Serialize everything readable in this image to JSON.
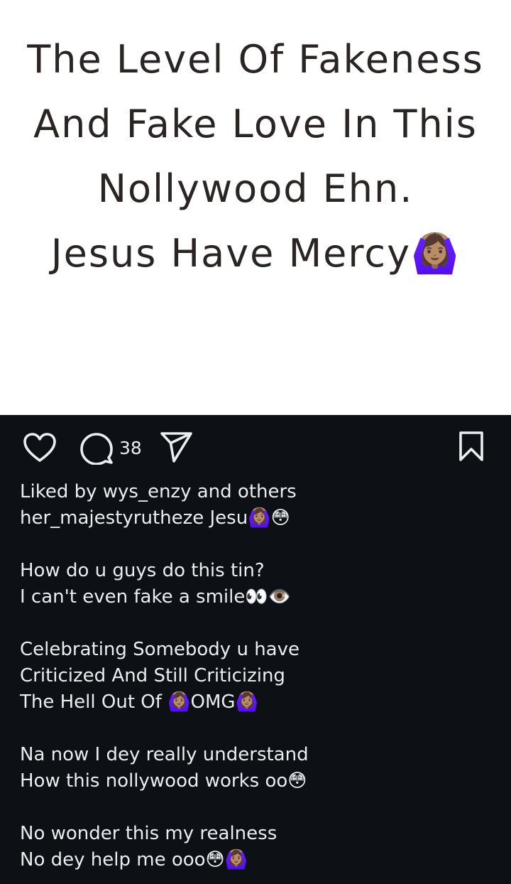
{
  "post": {
    "text_lines": [
      "The Level Of Fakeness",
      "And Fake Love In This",
      "Nollywood Ehn.",
      "Jesus Have Mercy🙆🏽‍♀️"
    ],
    "background_color": "#ffffff",
    "text_color": "#2a2522"
  },
  "actions": {
    "like_icon": "heart-outline-icon",
    "comment_icon": "speech-bubble-icon",
    "comment_count": "38",
    "share_icon": "paper-plane-icon",
    "save_icon": "bookmark-outline-icon"
  },
  "caption": {
    "liked_by": "Liked by wys_enzy and others",
    "author_line": "her_majestyrutheze Jesu🙆🏽‍♀️😳",
    "paragraphs": [
      [
        "How do u guys do this tin?",
        "I can't even fake a smile👀👁️"
      ],
      [
        "Celebrating Somebody u have",
        "Criticized And Still Criticizing",
        "The Hell Out Of 🙆🏽‍♀️OMG🙆🏽‍♀️"
      ],
      [
        "Na now I dey really understand",
        "How this nollywood works oo😳"
      ],
      [
        "No wonder this my realness",
        "No dey help me ooo😳🙆🏽‍♀️"
      ]
    ]
  },
  "theme": {
    "panel_bg": "#0d1015",
    "panel_text": "#ecedee"
  }
}
